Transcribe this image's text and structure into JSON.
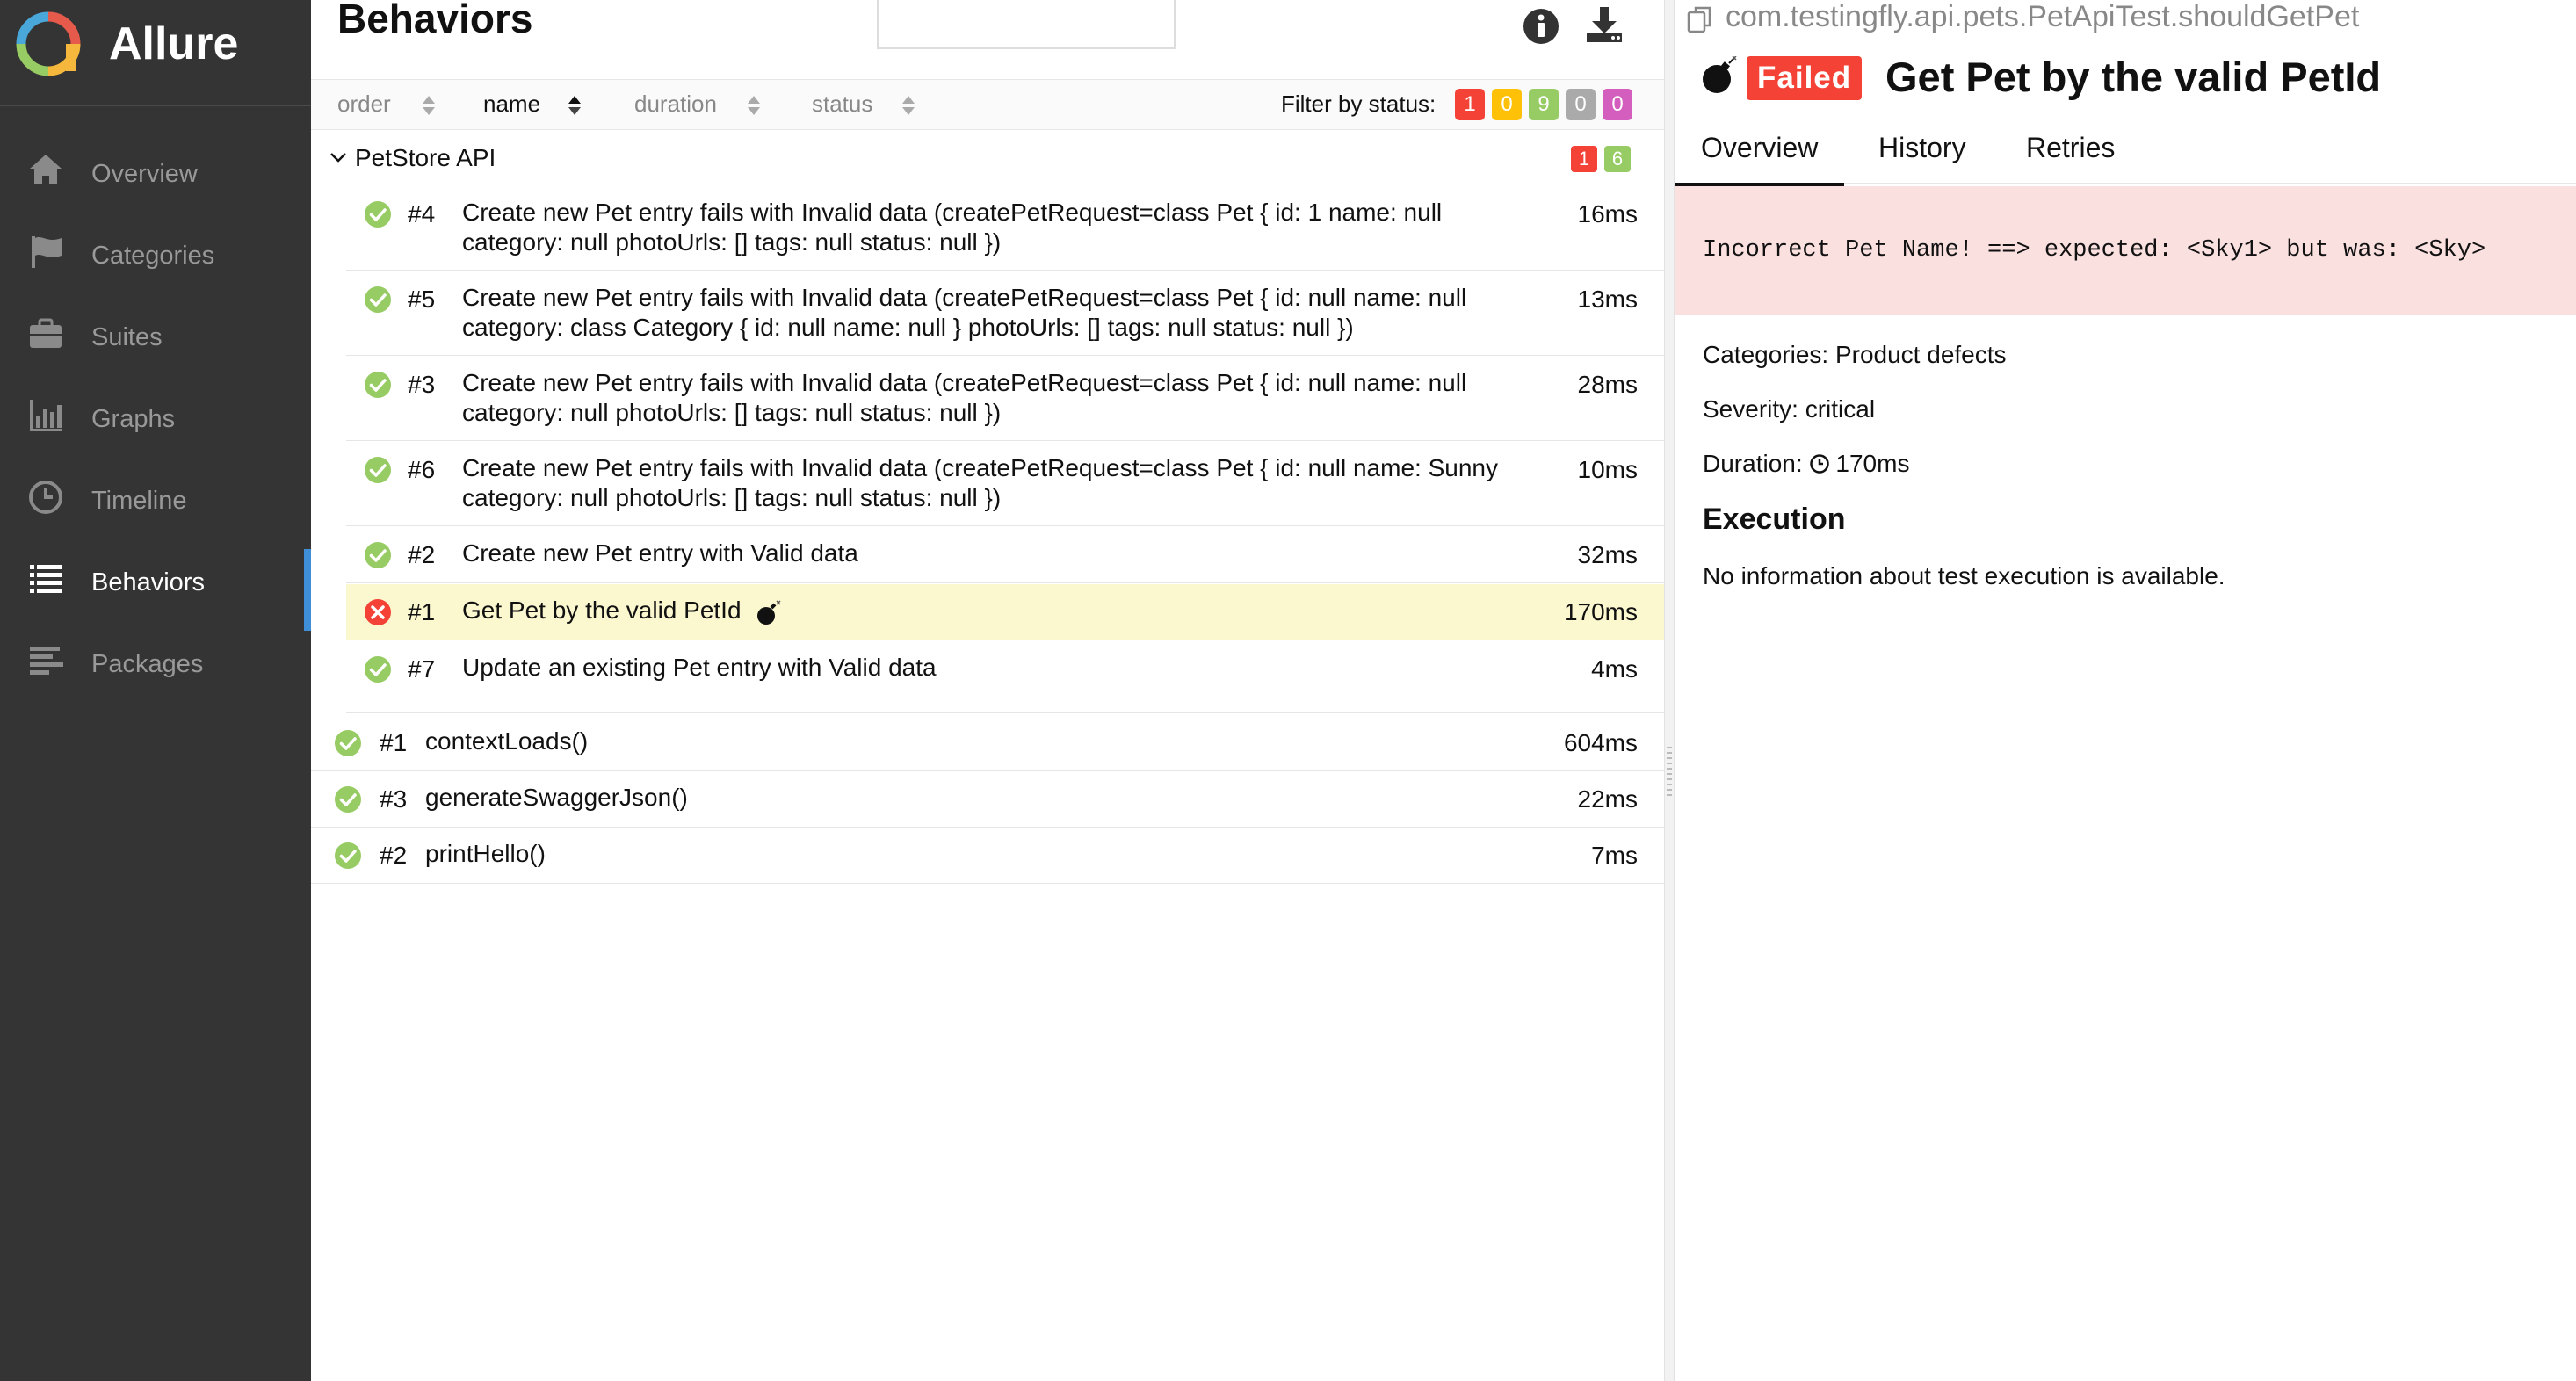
{
  "app": {
    "name": "Allure",
    "colors": {
      "sidebar": "#343434",
      "accent": "#3f8fd8",
      "failed": "#f44336",
      "broken": "#ffc107",
      "passed": "#97cc64",
      "skipped": "#aaaaaa",
      "unknown": "#d35ebe"
    }
  },
  "sidebar": {
    "items": [
      {
        "label": "Overview",
        "icon": "home-icon"
      },
      {
        "label": "Categories",
        "icon": "flag-icon"
      },
      {
        "label": "Suites",
        "icon": "briefcase-icon"
      },
      {
        "label": "Graphs",
        "icon": "bar-chart-icon"
      },
      {
        "label": "Timeline",
        "icon": "clock-icon"
      },
      {
        "label": "Behaviors",
        "icon": "list-icon",
        "active": true
      },
      {
        "label": "Packages",
        "icon": "align-left-icon"
      }
    ]
  },
  "tree": {
    "title": "Behaviors",
    "sort": {
      "order": "order",
      "name": "name",
      "duration": "duration",
      "status": "status"
    },
    "filter": {
      "label": "Filter by status:",
      "counts": {
        "failed": "1",
        "broken": "0",
        "passed": "9",
        "skipped": "0",
        "unknown": "0"
      }
    },
    "group": {
      "name": "PetStore API",
      "failed": "1",
      "passed": "6"
    },
    "group_items": [
      {
        "status": "passed",
        "num": "#4",
        "name": "Create new Pet entry fails with Invalid data (createPetRequest=class Pet { id: 1 name: null category: null photoUrls: [] tags: null status: null })",
        "duration": "16ms"
      },
      {
        "status": "passed",
        "num": "#5",
        "name": "Create new Pet entry fails with Invalid data (createPetRequest=class Pet { id: null name: null category: class Category { id: null name: null } photoUrls: [] tags: null status: null })",
        "duration": "13ms"
      },
      {
        "status": "passed",
        "num": "#3",
        "name": "Create new Pet entry fails with Invalid data (createPetRequest=class Pet { id: null name: null category: null photoUrls: [] tags: null status: null })",
        "duration": "28ms"
      },
      {
        "status": "passed",
        "num": "#6",
        "name": "Create new Pet entry fails with Invalid data (createPetRequest=class Pet { id: null name: Sunny category: null photoUrls: [] tags: null status: null })",
        "duration": "10ms"
      },
      {
        "status": "passed",
        "num": "#2",
        "name": "Create new Pet entry with Valid data",
        "duration": "32ms"
      },
      {
        "status": "failed",
        "num": "#1",
        "name": "Get Pet by the valid PetId",
        "duration": "170ms",
        "flaky_icon": "bomb-icon"
      },
      {
        "status": "passed",
        "num": "#7",
        "name": "Update an existing Pet entry with Valid data",
        "duration": "4ms"
      }
    ],
    "root_items": [
      {
        "status": "passed",
        "num": "#1",
        "name": "contextLoads()",
        "duration": "604ms"
      },
      {
        "status": "passed",
        "num": "#3",
        "name": "generateSwaggerJson()",
        "duration": "22ms"
      },
      {
        "status": "passed",
        "num": "#2",
        "name": "printHello()",
        "duration": "7ms"
      }
    ]
  },
  "details": {
    "full_name": "com.testingfly.api.pets.PetApiTest.shouldGetPet",
    "status": "Failed",
    "title": "Get Pet by the valid PetId",
    "tabs": [
      "Overview",
      "History",
      "Retries"
    ],
    "error": "Incorrect Pet Name! ==> expected: <Sky1> but was: <Sky>",
    "categories": "Categories: Product defects",
    "severity": "Severity: critical",
    "duration_label": "Duration:",
    "duration": "170ms",
    "execution_title": "Execution",
    "execution_text": "No information about test execution is available."
  }
}
